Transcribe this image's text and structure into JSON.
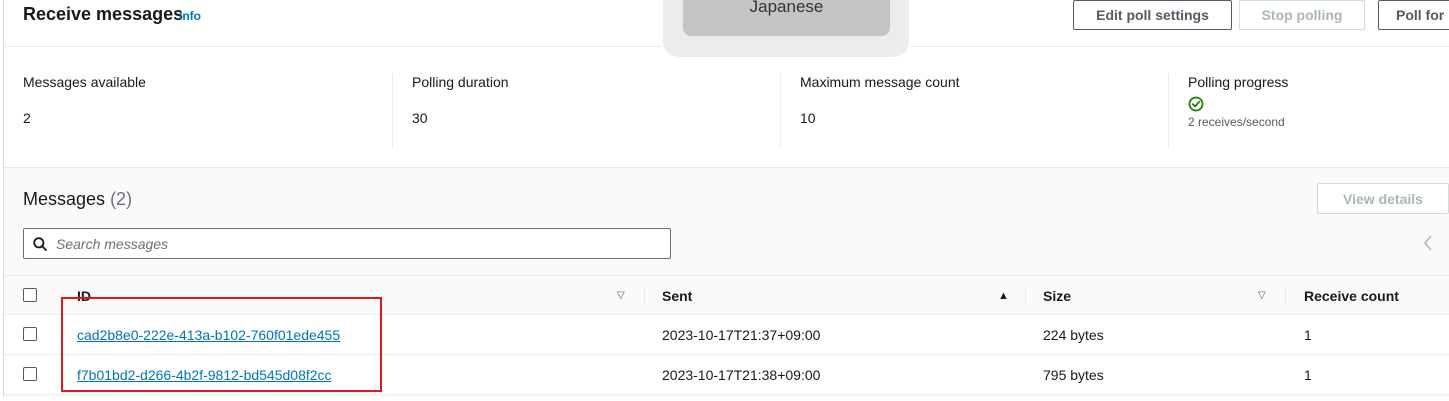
{
  "header": {
    "title": "Receive messages",
    "info": "Info",
    "edit_button": "Edit poll settings",
    "stop_button": "Stop polling",
    "poll_button": "Poll for messages"
  },
  "overlay": {
    "language": "Japanese"
  },
  "stats": {
    "available_label": "Messages available",
    "available_value": "2",
    "duration_label": "Polling duration",
    "duration_value": "30",
    "max_label": "Maximum message count",
    "max_value": "10",
    "progress_label": "Polling progress",
    "progress_rate": "2 receives/second"
  },
  "messages": {
    "title": "Messages",
    "count": "(2)",
    "view_button": "View details",
    "search_placeholder": "Search messages"
  },
  "table": {
    "columns": {
      "id": "ID",
      "sent": "Sent",
      "size": "Size",
      "receive_count": "Receive count"
    },
    "rows": [
      {
        "id": "cad2b8e0-222e-413a-b102-760f01ede455",
        "sent": "2023-10-17T21:37+09:00",
        "size": "224 bytes",
        "receive_count": "1"
      },
      {
        "id": "f7b01bd2-d266-4b2f-9812-bd545d08f2cc",
        "sent": "2023-10-17T21:38+09:00",
        "size": "795 bytes",
        "receive_count": "1"
      }
    ]
  },
  "colors": {
    "link": "#0073bb",
    "success": "#1d8102",
    "highlight": "#e8141b"
  },
  "icons": [
    "success-check-icon",
    "search-icon",
    "chevron-left-icon",
    "sort-down-icon",
    "sort-up-icon"
  ]
}
